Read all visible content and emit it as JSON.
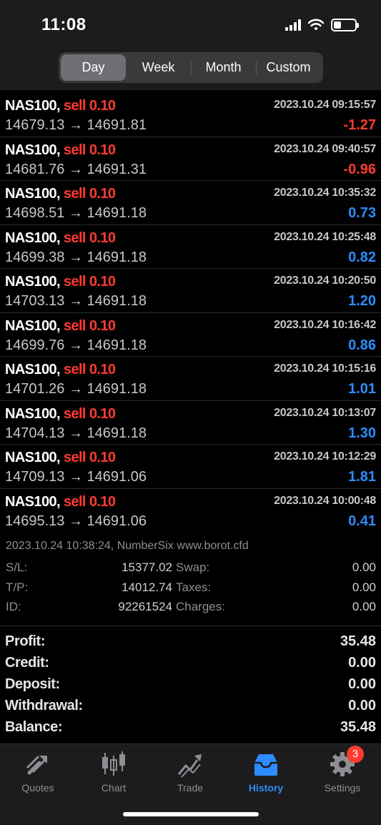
{
  "status": {
    "time": "11:08"
  },
  "period_tabs": [
    {
      "label": "Day",
      "active": true
    },
    {
      "label": "Week",
      "active": false
    },
    {
      "label": "Month",
      "active": false
    },
    {
      "label": "Custom",
      "active": false
    }
  ],
  "trades": [
    {
      "symbol": "NAS100,",
      "side": "sell 0.10",
      "time": "2023.10.24 09:15:57",
      "prices": "14679.13 → 14691.81",
      "profit": "-1.27",
      "sign": "neg"
    },
    {
      "symbol": "NAS100,",
      "side": "sell 0.10",
      "time": "2023.10.24 09:40:57",
      "prices": "14681.76 → 14691.31",
      "profit": "-0.96",
      "sign": "neg"
    },
    {
      "symbol": "NAS100,",
      "side": "sell 0.10",
      "time": "2023.10.24 10:35:32",
      "prices": "14698.51 → 14691.18",
      "profit": "0.73",
      "sign": "pos"
    },
    {
      "symbol": "NAS100,",
      "side": "sell 0.10",
      "time": "2023.10.24 10:25:48",
      "prices": "14699.38 → 14691.18",
      "profit": "0.82",
      "sign": "pos"
    },
    {
      "symbol": "NAS100,",
      "side": "sell 0.10",
      "time": "2023.10.24 10:20:50",
      "prices": "14703.13 → 14691.18",
      "profit": "1.20",
      "sign": "pos"
    },
    {
      "symbol": "NAS100,",
      "side": "sell 0.10",
      "time": "2023.10.24 10:16:42",
      "prices": "14699.76 → 14691.18",
      "profit": "0.86",
      "sign": "pos"
    },
    {
      "symbol": "NAS100,",
      "side": "sell 0.10",
      "time": "2023.10.24 10:15:16",
      "prices": "14701.26 → 14691.18",
      "profit": "1.01",
      "sign": "pos"
    },
    {
      "symbol": "NAS100,",
      "side": "sell 0.10",
      "time": "2023.10.24 10:13:07",
      "prices": "14704.13 → 14691.18",
      "profit": "1.30",
      "sign": "pos"
    },
    {
      "symbol": "NAS100,",
      "side": "sell 0.10",
      "time": "2023.10.24 10:12:29",
      "prices": "14709.13 → 14691.06",
      "profit": "1.81",
      "sign": "pos"
    },
    {
      "symbol": "NAS100,",
      "side": "sell 0.10",
      "time": "2023.10.24 10:00:48",
      "prices": "14695.13 → 14691.06",
      "profit": "0.41",
      "sign": "pos"
    }
  ],
  "detail": {
    "header": "2023.10.24 10:38:24, NumberSix www.borot.cfd",
    "rows": [
      {
        "l1": "S/L:",
        "v1": "15377.02",
        "l2": "Swap:",
        "v2": "0.00"
      },
      {
        "l1": "T/P:",
        "v1": "14012.74",
        "l2": "Taxes:",
        "v2": "0.00"
      },
      {
        "l1": "ID:",
        "v1": "92261524",
        "l2": "Charges:",
        "v2": "0.00"
      }
    ]
  },
  "summary": [
    {
      "label": "Profit:",
      "value": "35.48"
    },
    {
      "label": "Credit:",
      "value": "0.00"
    },
    {
      "label": "Deposit:",
      "value": "0.00"
    },
    {
      "label": "Withdrawal:",
      "value": "0.00"
    },
    {
      "label": "Balance:",
      "value": "35.48"
    }
  ],
  "tabbar": [
    {
      "label": "Quotes",
      "icon": "quotes-icon",
      "active": false
    },
    {
      "label": "Chart",
      "icon": "chart-candles-icon",
      "active": false
    },
    {
      "label": "Trade",
      "icon": "trade-icon",
      "active": false
    },
    {
      "label": "History",
      "icon": "history-inbox-icon",
      "active": true
    },
    {
      "label": "Settings",
      "icon": "gear-icon",
      "active": false,
      "badge": "3"
    }
  ],
  "colors": {
    "loss": "#ff3b30",
    "gain": "#2d8cff",
    "accent": "#2d8cff"
  }
}
